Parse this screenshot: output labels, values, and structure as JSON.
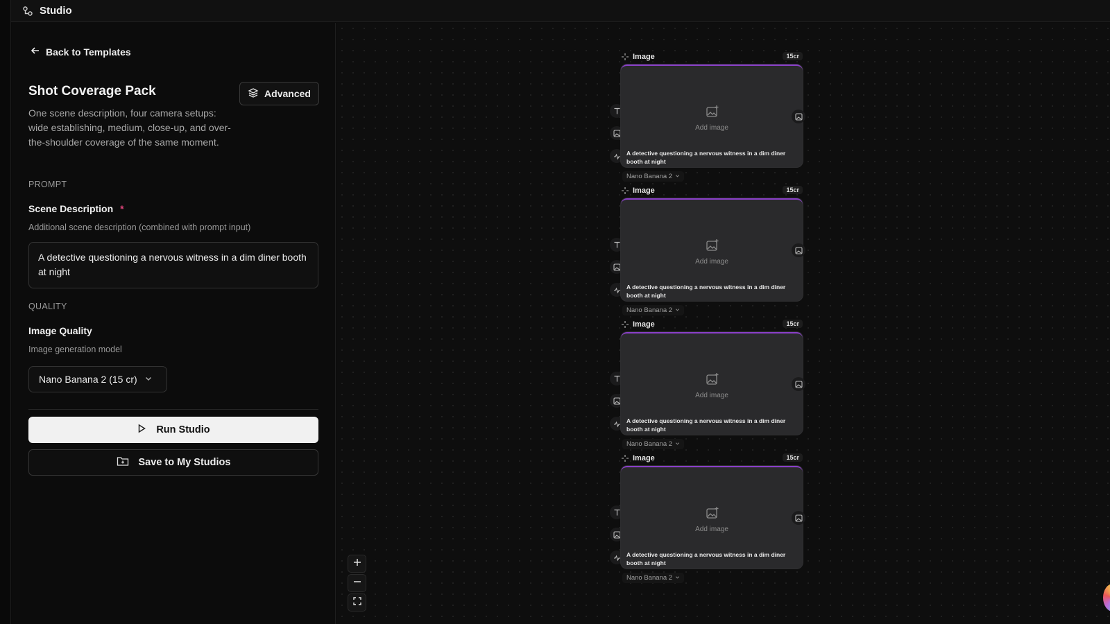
{
  "app": {
    "title": "Studio"
  },
  "panel": {
    "back_label": "Back to Templates",
    "title": "Shot Coverage Pack",
    "advanced_label": "Advanced",
    "description": "One scene description, four camera setups: wide establishing, medium, close-up, and over-the-shoulder coverage of the same moment.",
    "prompt_section": "PROMPT",
    "scene_label": "Scene Description",
    "required_mark": "*",
    "scene_hint": "Additional scene description (combined with prompt input)",
    "scene_value": "A detective questioning a nervous witness in a dim diner booth at night",
    "quality_section": "QUALITY",
    "quality_label": "Image Quality",
    "quality_hint": "Image generation model",
    "quality_value": "Nano Banana 2 (15 cr)",
    "run_label": "Run Studio",
    "save_label": "Save to My Studios"
  },
  "nodes": [
    {
      "type": "Image",
      "cost": "15cr",
      "add_label": "Add image",
      "prompt": "A detective questioning a nervous witness in a dim diner booth at night",
      "model": "Nano Banana 2"
    },
    {
      "type": "Image",
      "cost": "15cr",
      "add_label": "Add image",
      "prompt": "A detective questioning a nervous witness in a dim diner booth at night",
      "model": "Nano Banana 2"
    },
    {
      "type": "Image",
      "cost": "15cr",
      "add_label": "Add image",
      "prompt": "A detective questioning a nervous witness in a dim diner booth at night",
      "model": "Nano Banana 2"
    },
    {
      "type": "Image",
      "cost": "15cr",
      "add_label": "Add image",
      "prompt": "A detective questioning a nervous witness in a dim diner booth at night",
      "model": "Nano Banana 2"
    }
  ],
  "zoom_controls": {
    "zoom_in": "+",
    "zoom_out": "—"
  },
  "colors": {
    "accent": "#8a3fc9",
    "required": "#e0457b",
    "background": "#0b0b0b"
  }
}
